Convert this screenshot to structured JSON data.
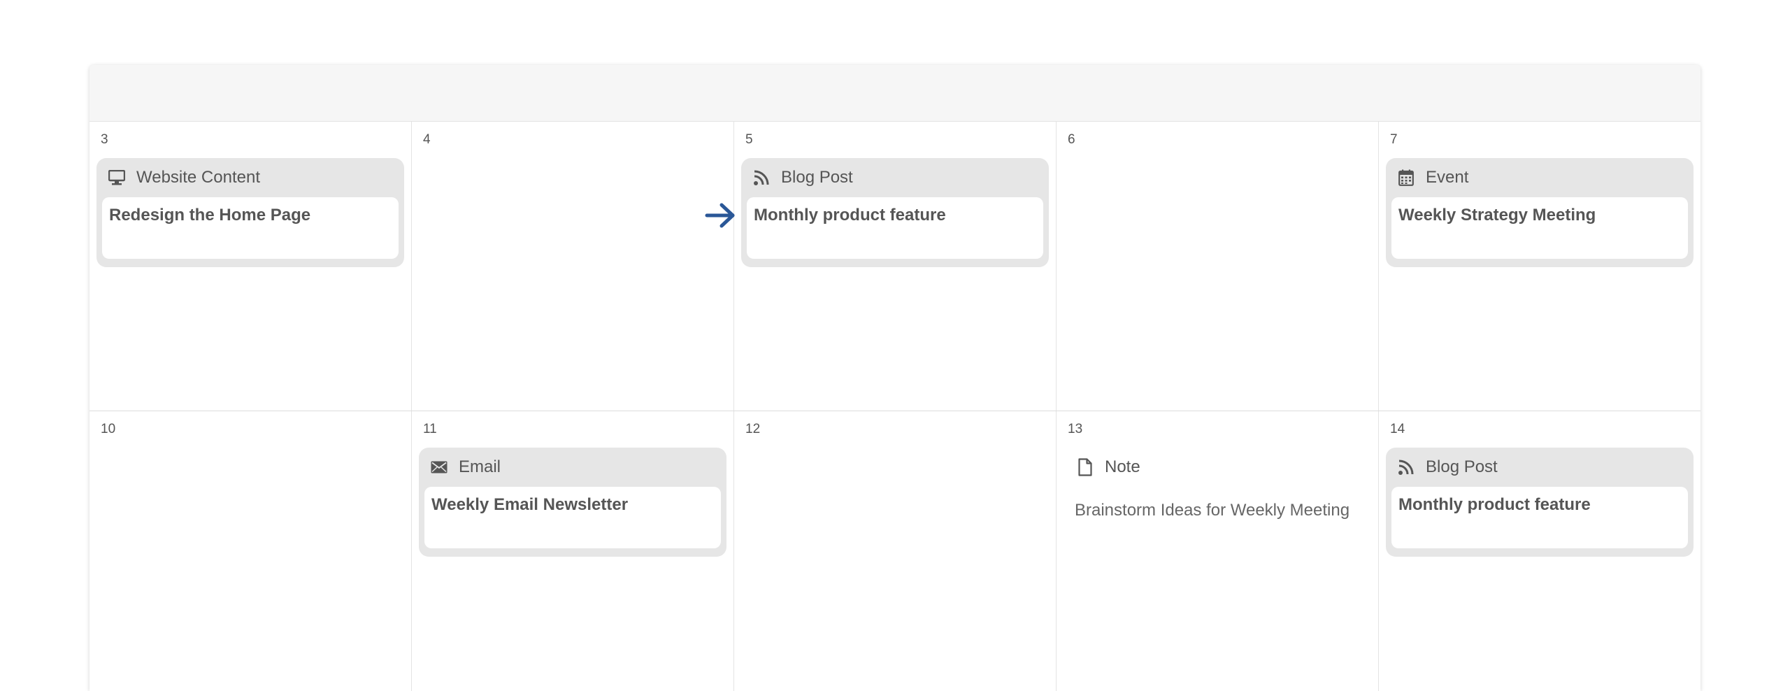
{
  "colors": {
    "arrow": "#2a5797",
    "card_bg": "#e6e6e6",
    "header_bg": "#f6f6f6"
  },
  "weeks": [
    {
      "days": [
        {
          "num": "3",
          "item": {
            "type": "Website Content",
            "icon": "monitor-icon",
            "title": "Redesign the Home Page"
          }
        },
        {
          "num": "4"
        },
        {
          "num": "5",
          "item": {
            "type": "Blog Post",
            "icon": "rss-icon",
            "title": "Monthly product feature"
          }
        },
        {
          "num": "6"
        },
        {
          "num": "7",
          "item": {
            "type": "Event",
            "icon": "calendar-icon",
            "title": "Weekly Strategy Meeting"
          }
        }
      ]
    },
    {
      "days": [
        {
          "num": "10"
        },
        {
          "num": "11",
          "item": {
            "type": "Email",
            "icon": "envelope-icon",
            "title": "Weekly Email Newsletter"
          }
        },
        {
          "num": "12"
        },
        {
          "num": "13",
          "note": {
            "type": "Note",
            "icon": "document-icon",
            "text": "Brainstorm Ideas for Weekly Meeting"
          }
        },
        {
          "num": "14",
          "item": {
            "type": "Blog Post",
            "icon": "rss-icon",
            "title": "Monthly product feature"
          }
        }
      ]
    }
  ]
}
